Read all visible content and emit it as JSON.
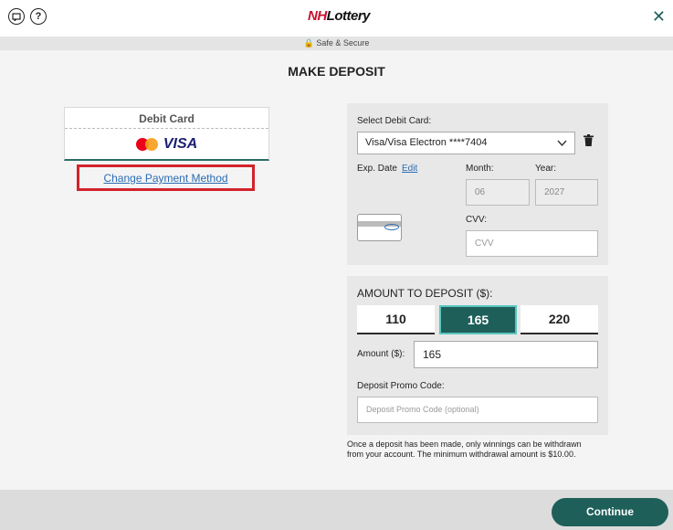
{
  "header": {
    "logo_nh": "NH",
    "logo_lottery": "Lottery",
    "help_icon_glyph": "?",
    "close_glyph": "✕"
  },
  "secure_bar": {
    "text": "🔒 Safe & Secure"
  },
  "page_title": "MAKE DEPOSIT",
  "payment_method": {
    "title": "Debit Card",
    "visa_text": "VISA",
    "change_link": "Change Payment Method"
  },
  "card_form": {
    "select_label": "Select Debit Card:",
    "selected_card": "Visa/Visa Electron ****7404",
    "exp_label": "Exp. Date",
    "edit_link": "Edit",
    "month_label": "Month:",
    "year_label": "Year:",
    "month_value": "06",
    "year_value": "2027",
    "cvv_label": "CVV:",
    "cvv_placeholder": "CVV"
  },
  "deposit": {
    "title": "AMOUNT TO DEPOSIT ($):",
    "amounts": [
      "110",
      "165",
      "220"
    ],
    "selected_amount": "165",
    "amount_label": "Amount ($):",
    "amount_value": "165",
    "promo_label": "Deposit Promo Code:",
    "promo_placeholder": "Deposit Promo Code (optional)"
  },
  "notice": "Once a deposit has been made, only winnings can be withdrawn from your account. The minimum withdrawal amount is $10.00.",
  "footer": {
    "continue_label": "Continue"
  },
  "colors": {
    "accent": "#1e5f5a",
    "highlight": "#d2232a",
    "link": "#2a6db4"
  }
}
